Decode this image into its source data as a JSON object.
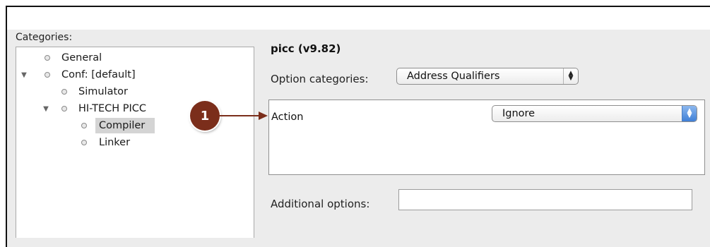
{
  "categories": {
    "label": "Categories:",
    "items": [
      {
        "label": "General",
        "expanded": null,
        "level": 1,
        "selected": false
      },
      {
        "label": "Conf: [default]",
        "expanded": true,
        "level": 1,
        "selected": false
      },
      {
        "label": "Simulator",
        "expanded": null,
        "level": 2,
        "selected": false
      },
      {
        "label": "HI-TECH PICC",
        "expanded": true,
        "level": 2,
        "selected": false
      },
      {
        "label": "Compiler",
        "expanded": null,
        "level": 3,
        "selected": true
      },
      {
        "label": "Linker",
        "expanded": null,
        "level": 3,
        "selected": false
      }
    ]
  },
  "panel": {
    "title": "picc (v9.82)",
    "option_categories_label": "Option categories:",
    "option_categories_value": "Address Qualifiers",
    "action_label": "Action",
    "action_value": "Ignore",
    "additional_options_label": "Additional options:",
    "additional_options_value": ""
  },
  "callout": {
    "number": "1",
    "color": "#7b2e1b"
  }
}
